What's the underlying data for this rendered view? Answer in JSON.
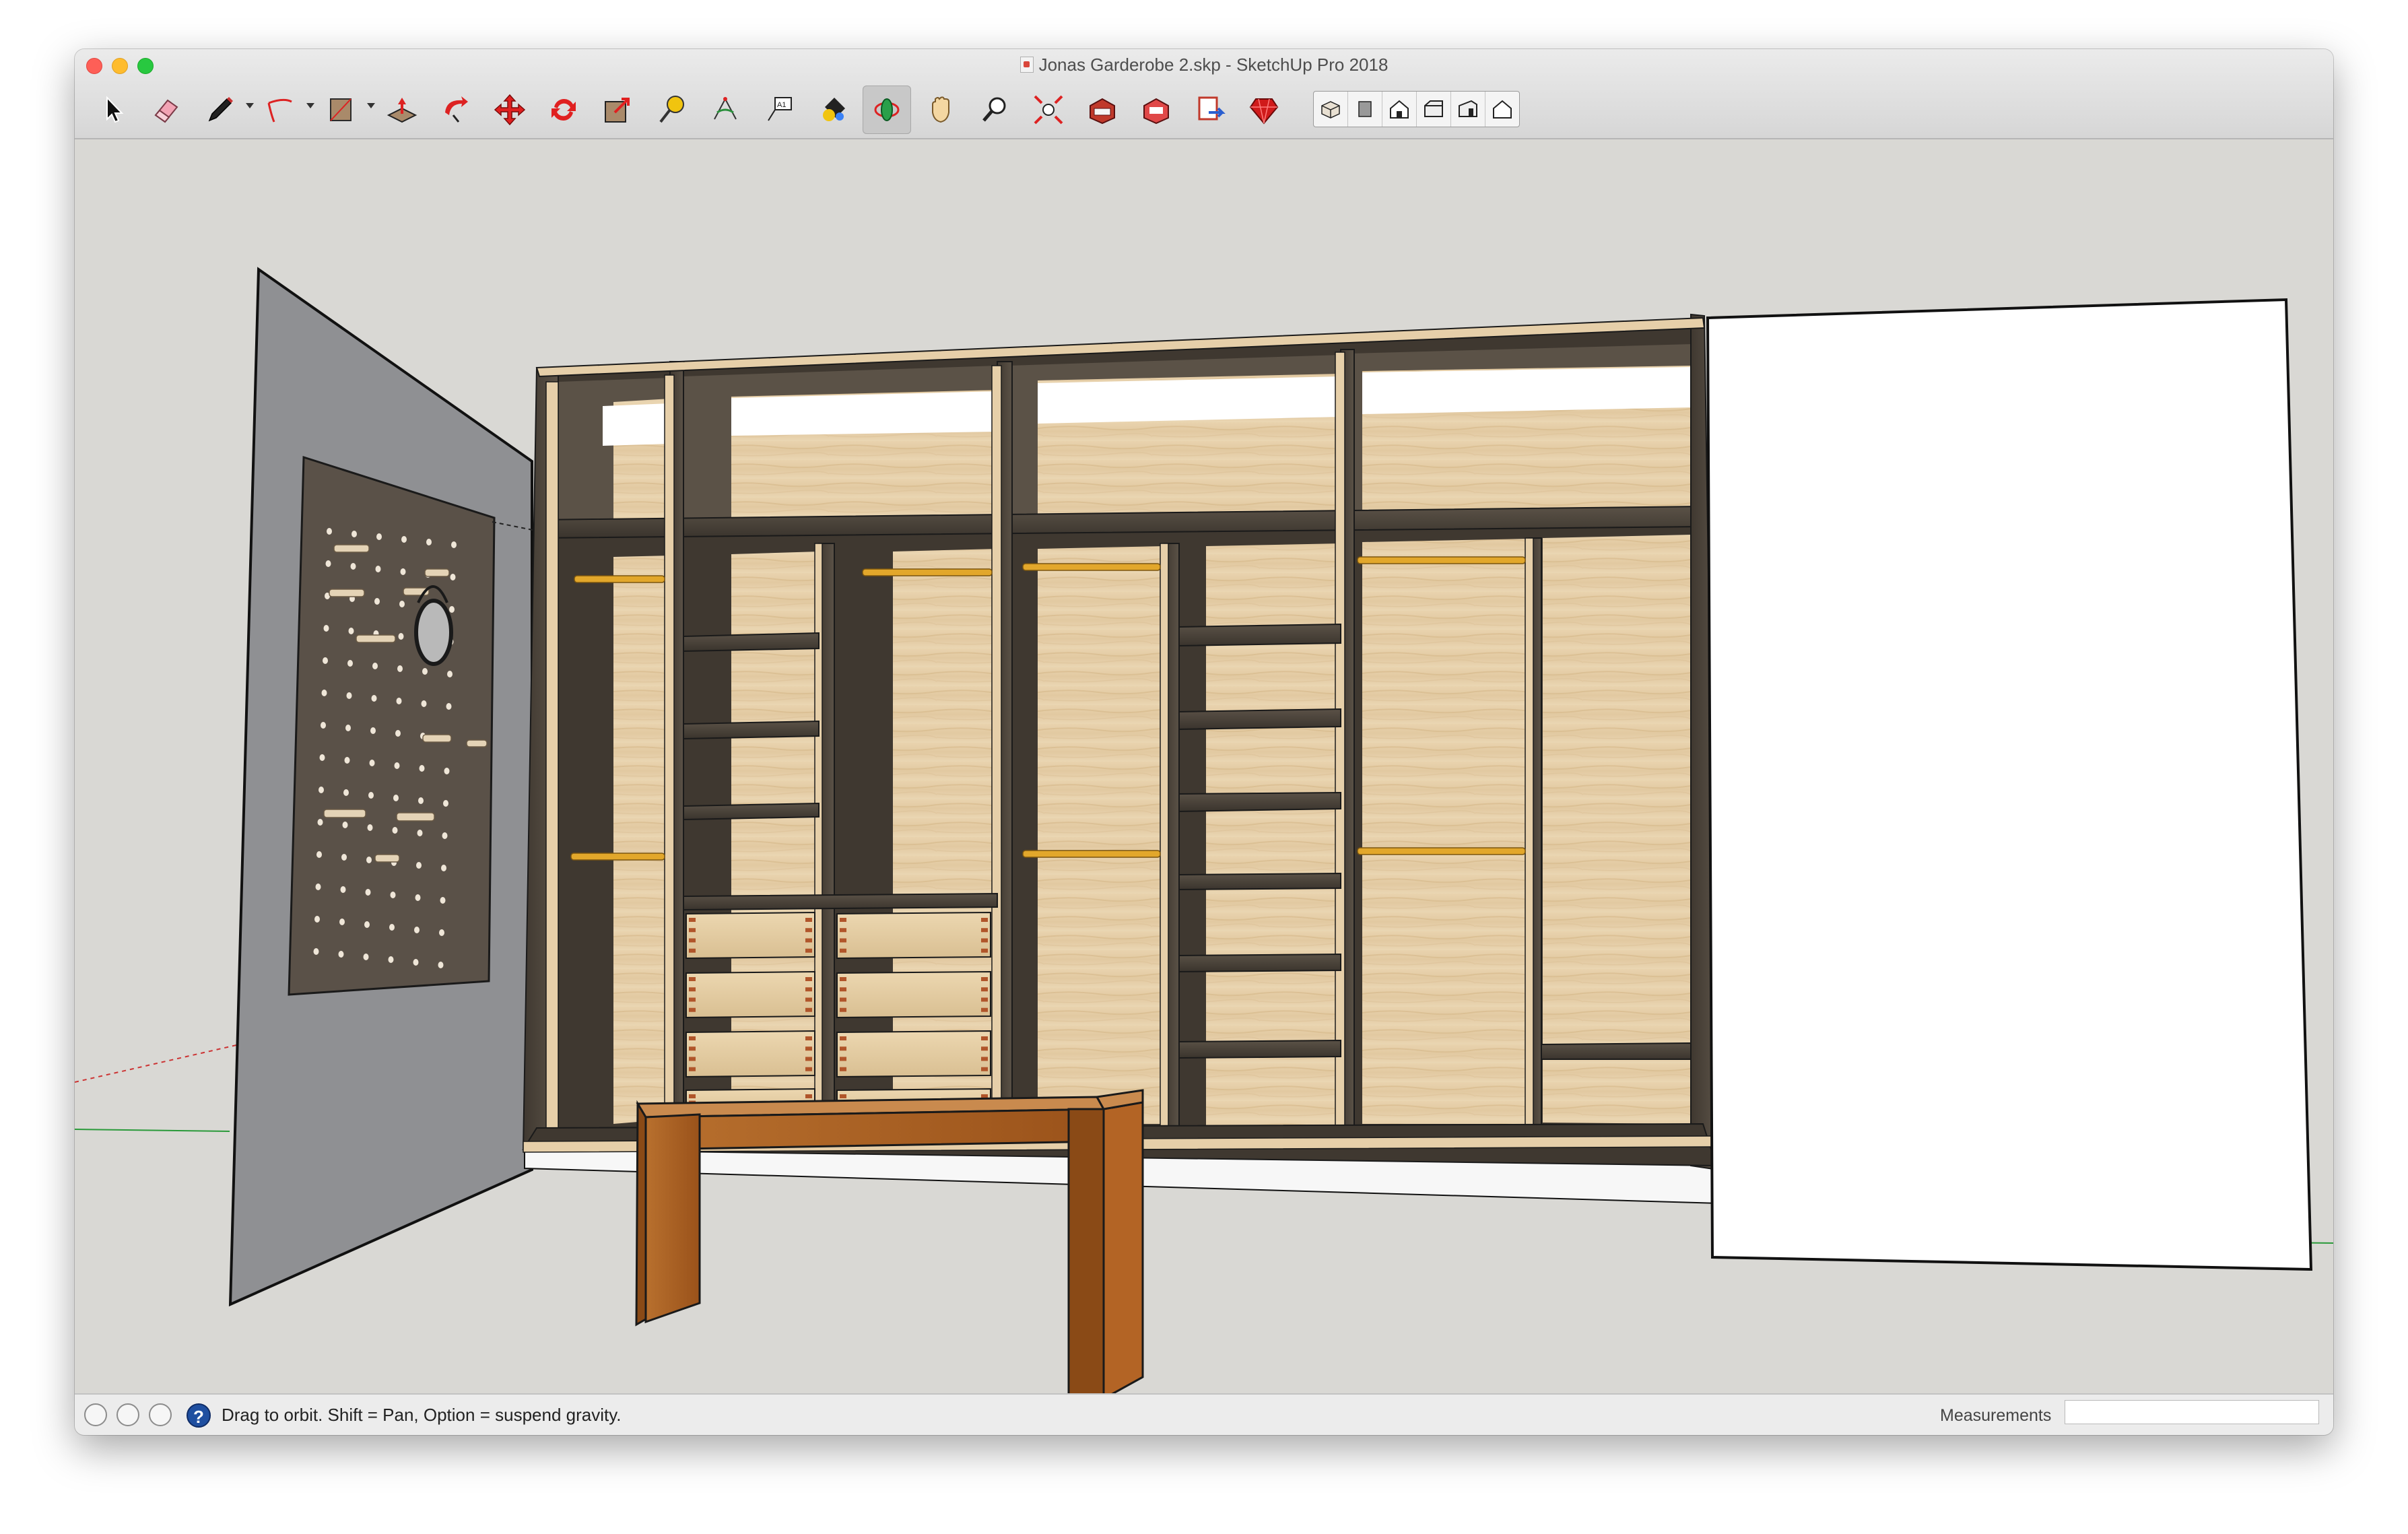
{
  "window": {
    "title": "Jonas Garderobe 2.skp - SketchUp Pro 2018"
  },
  "toolbar": {
    "tools": [
      {
        "name": "select-tool",
        "icon": "arrow-cursor-icon"
      },
      {
        "name": "eraser-tool",
        "icon": "eraser-icon"
      },
      {
        "name": "line-tool",
        "icon": "pencil-icon"
      },
      {
        "name": "arc-tool",
        "icon": "arc-icon"
      },
      {
        "name": "rectangle-tool",
        "icon": "rectangle-icon"
      },
      {
        "name": "push-pull-tool",
        "icon": "push-pull-icon"
      },
      {
        "name": "follow-me-tool",
        "icon": "follow-me-icon"
      },
      {
        "name": "move-tool",
        "icon": "move-arrows-icon"
      },
      {
        "name": "rotate-tool",
        "icon": "rotate-icon"
      },
      {
        "name": "scale-tool",
        "icon": "scale-icon"
      },
      {
        "name": "tape-measure-tool",
        "icon": "tape-measure-icon"
      },
      {
        "name": "protractor-tool",
        "icon": "protractor-icon"
      },
      {
        "name": "text-tool",
        "icon": "text-label-icon"
      },
      {
        "name": "paint-bucket-tool",
        "icon": "paint-bucket-icon"
      },
      {
        "name": "orbit-tool",
        "icon": "orbit-icon",
        "active": true
      },
      {
        "name": "pan-tool",
        "icon": "hand-icon"
      },
      {
        "name": "zoom-tool",
        "icon": "magnifier-icon"
      },
      {
        "name": "zoom-extents-tool",
        "icon": "zoom-extents-icon"
      },
      {
        "name": "warehouse-tool",
        "icon": "3d-warehouse-icon"
      },
      {
        "name": "extension-warehouse-tool",
        "icon": "extension-warehouse-icon"
      },
      {
        "name": "layout-send-tool",
        "icon": "send-to-layout-icon"
      },
      {
        "name": "extension-manager-tool",
        "icon": "ruby-gem-icon"
      }
    ],
    "views": [
      {
        "name": "iso-view",
        "icon": "iso-view-icon"
      },
      {
        "name": "top-view",
        "icon": "top-view-icon"
      },
      {
        "name": "front-view",
        "icon": "front-view-icon"
      },
      {
        "name": "right-view",
        "icon": "right-view-icon"
      },
      {
        "name": "back-view",
        "icon": "back-view-icon"
      },
      {
        "name": "left-view",
        "icon": "left-view-icon"
      }
    ]
  },
  "colors": {
    "wood_light": "#e6cfa9",
    "wood_dark": "#4e463c",
    "rod": "#e2a72b",
    "bench": "#a35a1f",
    "wall_grey": "#8f9093",
    "background": "#d9d8d4"
  },
  "statusbar": {
    "hint": "Drag to orbit. Shift = Pan, Option = suspend gravity.",
    "measurements_label": "Measurements",
    "measurements_value": ""
  }
}
